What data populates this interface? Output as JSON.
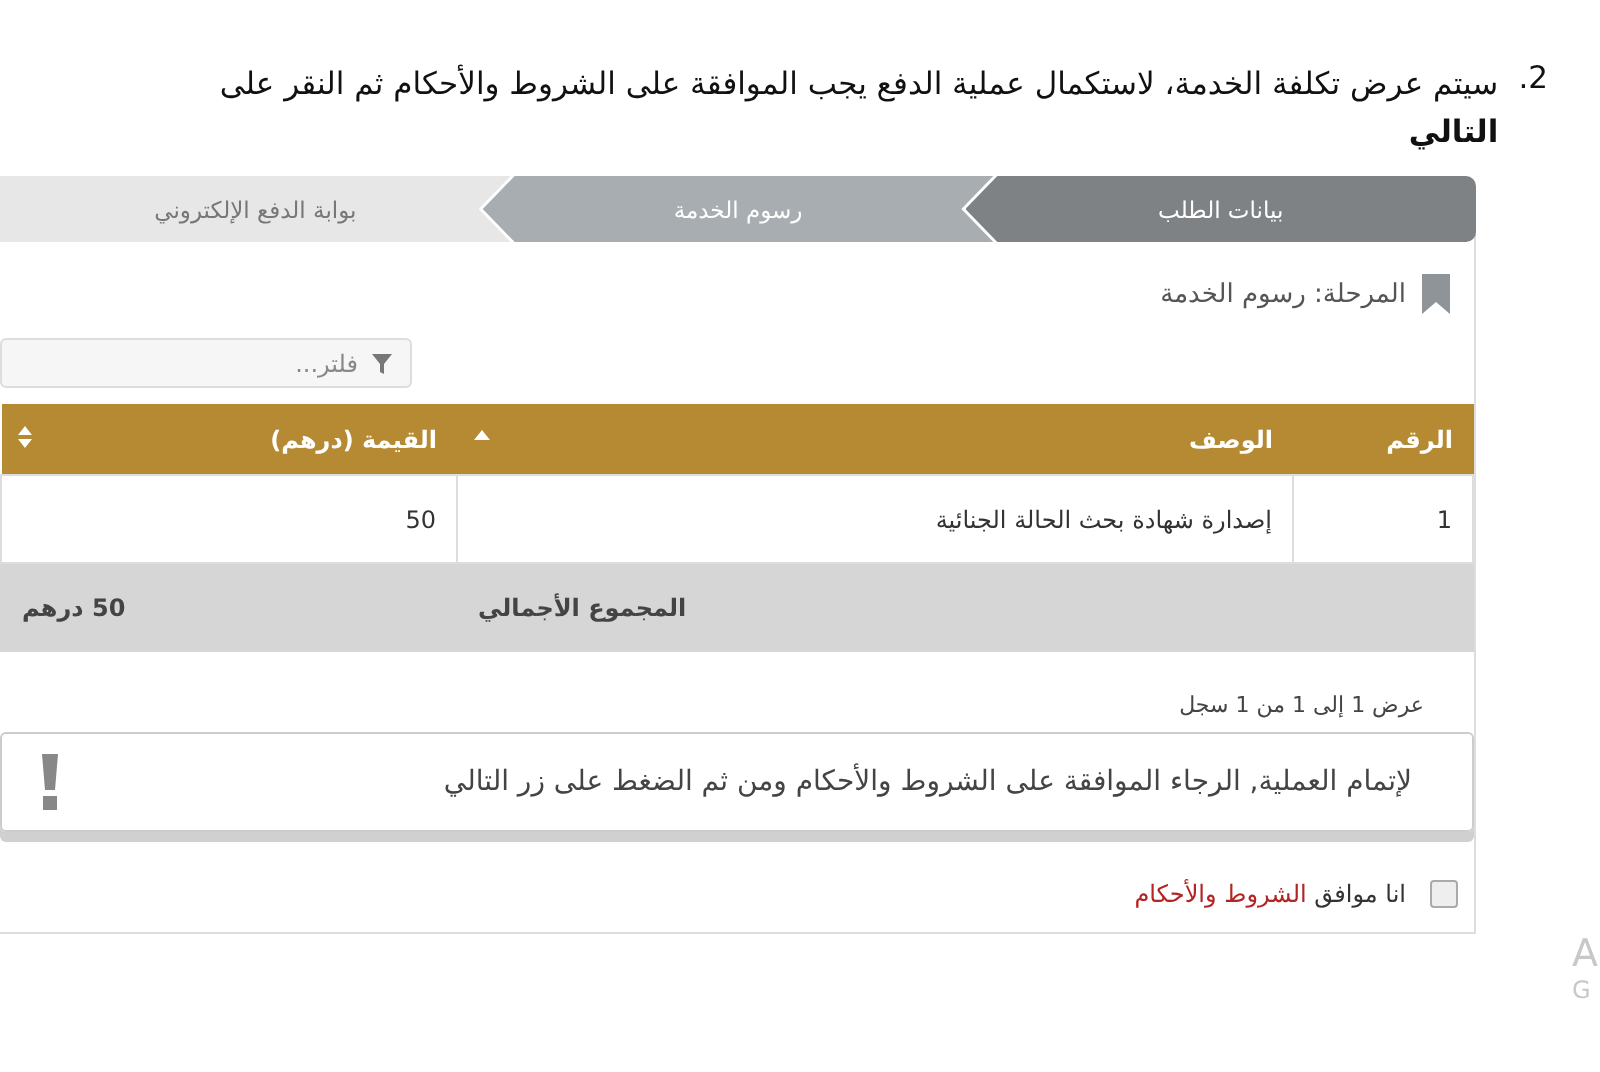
{
  "instruction": {
    "number": "2.",
    "text": "سيتم عرض تكلفة الخدمة، لاستكمال عملية الدفع يجب الموافقة على الشروط والأحكام ثم النقر على **التالي**"
  },
  "steps": [
    {
      "label": "بيانات الطلب",
      "completed": true,
      "selected": false
    },
    {
      "label": "رسوم الخدمة",
      "completed": false,
      "selected": true
    },
    {
      "label": "بوابة الدفع الإلكتروني",
      "completed": false,
      "selected": false
    }
  ],
  "stage": {
    "label": "المرحلة: رسوم الخدمة"
  },
  "filter": {
    "placeholder": "فلتر..."
  },
  "table": {
    "columns": [
      {
        "label": "الرقم",
        "sortable": false,
        "sorted": false
      },
      {
        "label": "الوصف",
        "sortable": true,
        "sorted": true
      },
      {
        "label": "القيمة (درهم)",
        "sortable": true,
        "sorted": false
      }
    ],
    "rows": [
      [
        "1",
        "إصدارة شهادة بحث الحالة الجنائية",
        "50"
      ]
    ],
    "total": {
      "label": "المجموع الأجمالي",
      "value": "50 درهم"
    }
  },
  "records_info": "عرض 1 إلى 1 من 1 سجل",
  "alert": {
    "text": "لإتمام العملية, الرجاء الموافقة على الشروط والأحكام ومن ثم الضغط على زر التالي"
  },
  "agreement": {
    "checked": false,
    "text": "انا موافق",
    "link": "الشروط والأحكام"
  },
  "windows_notice": {
    "line_1": "A",
    "line_2": "G"
  }
}
